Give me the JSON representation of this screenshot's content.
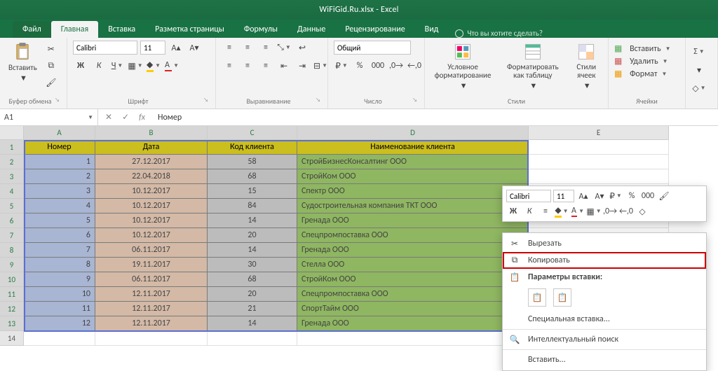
{
  "title": "WiFiGid.Ru.xlsx - Excel",
  "tabs": {
    "file": "Файл",
    "home": "Главная",
    "insert": "Вставка",
    "layout": "Разметка страницы",
    "formulas": "Формулы",
    "data": "Данные",
    "review": "Рецензирование",
    "view": "Вид",
    "tellme": "Что вы хотите сделать?"
  },
  "ribbon": {
    "paste": "Вставить",
    "clipboard": "Буфер обмена",
    "font_name": "Calibri",
    "font_size": "11",
    "font_group": "Шрифт",
    "align_group": "Выравнивание",
    "number_format": "Общий",
    "number_group": "Число",
    "cond_fmt": "Условное форматирование",
    "fmt_table": "Форматировать как таблицу",
    "cell_styles": "Стили ячеек",
    "styles_group": "Стили",
    "insert_btn": "Вставить",
    "delete_btn": "Удалить",
    "format_btn": "Формат",
    "cells_group": "Ячейки"
  },
  "namebox": "A1",
  "formula": "Номер",
  "columns": [
    "A",
    "B",
    "C",
    "D",
    "E"
  ],
  "headers": {
    "num": "Номер",
    "date": "Дата",
    "code": "Код клиента",
    "name": "Наименование клиента"
  },
  "rows": [
    {
      "n": "1",
      "d": "27.12.2017",
      "c": "58",
      "name": "СтройБизнесКонсалтинг ООО"
    },
    {
      "n": "2",
      "d": "22.04.2018",
      "c": "68",
      "name": "СтройКом ООО"
    },
    {
      "n": "3",
      "d": "10.12.2017",
      "c": "15",
      "name": "Спектр ООО"
    },
    {
      "n": "4",
      "d": "10.12.2017",
      "c": "84",
      "name": "Судостроительная компания ТКТ ООО"
    },
    {
      "n": "5",
      "d": "10.12.2017",
      "c": "14",
      "name": "Гренада ООО"
    },
    {
      "n": "6",
      "d": "10.12.2017",
      "c": "20",
      "name": "Спецпромпоставка ООО"
    },
    {
      "n": "7",
      "d": "06.11.2017",
      "c": "14",
      "name": "Гренада ООО"
    },
    {
      "n": "8",
      "d": "19.11.2017",
      "c": "30",
      "name": "Стелла ООО"
    },
    {
      "n": "9",
      "d": "06.11.2017",
      "c": "68",
      "name": "СтройКом ООО"
    },
    {
      "n": "10",
      "d": "12.11.2017",
      "c": "20",
      "name": "Спецпромпоставка ООО"
    },
    {
      "n": "11",
      "d": "12.11.2017",
      "c": "21",
      "name": "СпортТайм ООО"
    },
    {
      "n": "12",
      "d": "12.11.2017",
      "c": "14",
      "name": "Гренада ООО"
    }
  ],
  "mini": {
    "font": "Calibri",
    "size": "11"
  },
  "ctx": {
    "cut": "Вырезать",
    "copy": "Копировать",
    "paste_opts": "Параметры вставки:",
    "paste_special": "Специальная вставка...",
    "smart_lookup": "Интеллектуальный поиск",
    "insert": "Вставить..."
  }
}
